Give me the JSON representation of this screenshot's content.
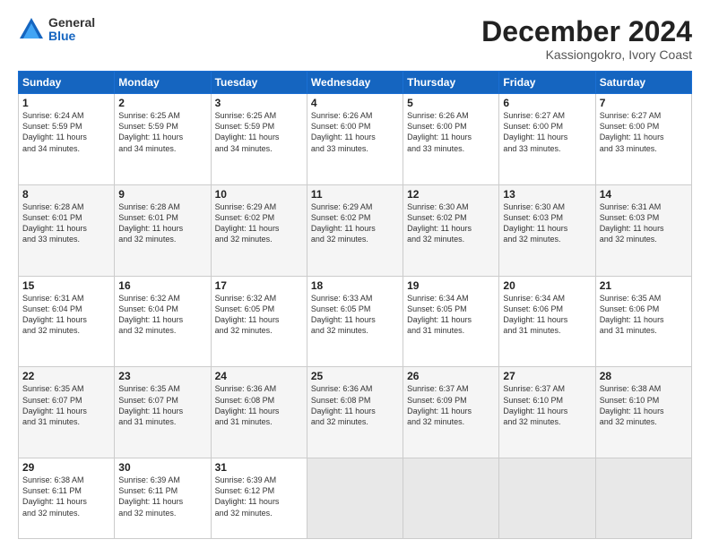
{
  "logo": {
    "general": "General",
    "blue": "Blue"
  },
  "title": "December 2024",
  "location": "Kassiongokro, Ivory Coast",
  "days_header": [
    "Sunday",
    "Monday",
    "Tuesday",
    "Wednesday",
    "Thursday",
    "Friday",
    "Saturday"
  ],
  "weeks": [
    [
      {
        "day": "1",
        "info": "Sunrise: 6:24 AM\nSunset: 5:59 PM\nDaylight: 11 hours\nand 34 minutes."
      },
      {
        "day": "2",
        "info": "Sunrise: 6:25 AM\nSunset: 5:59 PM\nDaylight: 11 hours\nand 34 minutes."
      },
      {
        "day": "3",
        "info": "Sunrise: 6:25 AM\nSunset: 5:59 PM\nDaylight: 11 hours\nand 34 minutes."
      },
      {
        "day": "4",
        "info": "Sunrise: 6:26 AM\nSunset: 6:00 PM\nDaylight: 11 hours\nand 33 minutes."
      },
      {
        "day": "5",
        "info": "Sunrise: 6:26 AM\nSunset: 6:00 PM\nDaylight: 11 hours\nand 33 minutes."
      },
      {
        "day": "6",
        "info": "Sunrise: 6:27 AM\nSunset: 6:00 PM\nDaylight: 11 hours\nand 33 minutes."
      },
      {
        "day": "7",
        "info": "Sunrise: 6:27 AM\nSunset: 6:00 PM\nDaylight: 11 hours\nand 33 minutes."
      }
    ],
    [
      {
        "day": "8",
        "info": "Sunrise: 6:28 AM\nSunset: 6:01 PM\nDaylight: 11 hours\nand 33 minutes."
      },
      {
        "day": "9",
        "info": "Sunrise: 6:28 AM\nSunset: 6:01 PM\nDaylight: 11 hours\nand 32 minutes."
      },
      {
        "day": "10",
        "info": "Sunrise: 6:29 AM\nSunset: 6:02 PM\nDaylight: 11 hours\nand 32 minutes."
      },
      {
        "day": "11",
        "info": "Sunrise: 6:29 AM\nSunset: 6:02 PM\nDaylight: 11 hours\nand 32 minutes."
      },
      {
        "day": "12",
        "info": "Sunrise: 6:30 AM\nSunset: 6:02 PM\nDaylight: 11 hours\nand 32 minutes."
      },
      {
        "day": "13",
        "info": "Sunrise: 6:30 AM\nSunset: 6:03 PM\nDaylight: 11 hours\nand 32 minutes."
      },
      {
        "day": "14",
        "info": "Sunrise: 6:31 AM\nSunset: 6:03 PM\nDaylight: 11 hours\nand 32 minutes."
      }
    ],
    [
      {
        "day": "15",
        "info": "Sunrise: 6:31 AM\nSunset: 6:04 PM\nDaylight: 11 hours\nand 32 minutes."
      },
      {
        "day": "16",
        "info": "Sunrise: 6:32 AM\nSunset: 6:04 PM\nDaylight: 11 hours\nand 32 minutes."
      },
      {
        "day": "17",
        "info": "Sunrise: 6:32 AM\nSunset: 6:05 PM\nDaylight: 11 hours\nand 32 minutes."
      },
      {
        "day": "18",
        "info": "Sunrise: 6:33 AM\nSunset: 6:05 PM\nDaylight: 11 hours\nand 32 minutes."
      },
      {
        "day": "19",
        "info": "Sunrise: 6:34 AM\nSunset: 6:05 PM\nDaylight: 11 hours\nand 31 minutes."
      },
      {
        "day": "20",
        "info": "Sunrise: 6:34 AM\nSunset: 6:06 PM\nDaylight: 11 hours\nand 31 minutes."
      },
      {
        "day": "21",
        "info": "Sunrise: 6:35 AM\nSunset: 6:06 PM\nDaylight: 11 hours\nand 31 minutes."
      }
    ],
    [
      {
        "day": "22",
        "info": "Sunrise: 6:35 AM\nSunset: 6:07 PM\nDaylight: 11 hours\nand 31 minutes."
      },
      {
        "day": "23",
        "info": "Sunrise: 6:35 AM\nSunset: 6:07 PM\nDaylight: 11 hours\nand 31 minutes."
      },
      {
        "day": "24",
        "info": "Sunrise: 6:36 AM\nSunset: 6:08 PM\nDaylight: 11 hours\nand 31 minutes."
      },
      {
        "day": "25",
        "info": "Sunrise: 6:36 AM\nSunset: 6:08 PM\nDaylight: 11 hours\nand 32 minutes."
      },
      {
        "day": "26",
        "info": "Sunrise: 6:37 AM\nSunset: 6:09 PM\nDaylight: 11 hours\nand 32 minutes."
      },
      {
        "day": "27",
        "info": "Sunrise: 6:37 AM\nSunset: 6:10 PM\nDaylight: 11 hours\nand 32 minutes."
      },
      {
        "day": "28",
        "info": "Sunrise: 6:38 AM\nSunset: 6:10 PM\nDaylight: 11 hours\nand 32 minutes."
      }
    ],
    [
      {
        "day": "29",
        "info": "Sunrise: 6:38 AM\nSunset: 6:11 PM\nDaylight: 11 hours\nand 32 minutes."
      },
      {
        "day": "30",
        "info": "Sunrise: 6:39 AM\nSunset: 6:11 PM\nDaylight: 11 hours\nand 32 minutes."
      },
      {
        "day": "31",
        "info": "Sunrise: 6:39 AM\nSunset: 6:12 PM\nDaylight: 11 hours\nand 32 minutes."
      },
      {
        "day": "",
        "info": ""
      },
      {
        "day": "",
        "info": ""
      },
      {
        "day": "",
        "info": ""
      },
      {
        "day": "",
        "info": ""
      }
    ]
  ]
}
